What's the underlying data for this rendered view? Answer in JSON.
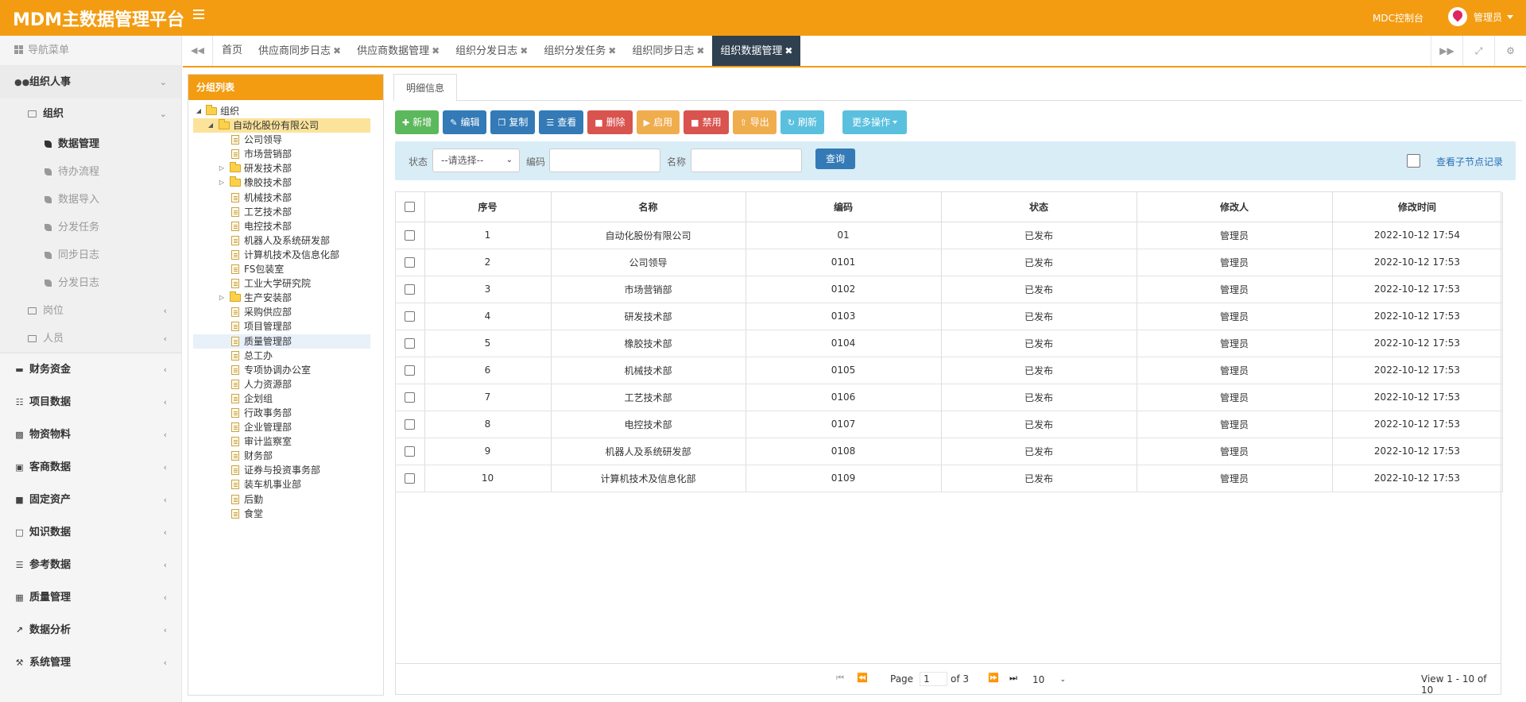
{
  "header": {
    "app_title": "MDM主数据管理平台",
    "console_link": "MDC控制台",
    "user_name": "管理员"
  },
  "sidebar": {
    "nav_title": "导航菜单",
    "groups": [
      {
        "label": "组织人事",
        "icon": "users-icon"
      },
      {
        "label": "财务资金",
        "icon": "card-icon"
      },
      {
        "label": "项目数据",
        "icon": "sitemap-icon"
      },
      {
        "label": "物资物料",
        "icon": "cubes-icon"
      },
      {
        "label": "客商数据",
        "icon": "briefcase-icon"
      },
      {
        "label": "固定资产",
        "icon": "archive-icon"
      },
      {
        "label": "知识数据",
        "icon": "file-icon"
      },
      {
        "label": "参考数据",
        "icon": "list-icon"
      },
      {
        "label": "质量管理",
        "icon": "table-icon"
      },
      {
        "label": "数据分析",
        "icon": "chart-icon"
      },
      {
        "label": "系统管理",
        "icon": "wrench-icon"
      }
    ],
    "org_label": "组织",
    "org_items": [
      "数据管理",
      "待办流程",
      "数据导入",
      "分发任务",
      "同步日志",
      "分发日志"
    ],
    "post_label": "岗位",
    "person_label": "人员"
  },
  "tabs": [
    "首页",
    "供应商同步日志",
    "供应商数据管理",
    "组织分发日志",
    "组织分发任务",
    "组织同步日志",
    "组织数据管理"
  ],
  "tree": {
    "title": "分组列表",
    "root": "组织",
    "company": "自动化股份有限公司",
    "children": [
      {
        "label": "公司领导",
        "type": "doc"
      },
      {
        "label": "市场营销部",
        "type": "doc"
      },
      {
        "label": "研发技术部",
        "type": "folder"
      },
      {
        "label": "橡胶技术部",
        "type": "folder"
      },
      {
        "label": "机械技术部",
        "type": "doc"
      },
      {
        "label": "工艺技术部",
        "type": "doc"
      },
      {
        "label": "电控技术部",
        "type": "doc"
      },
      {
        "label": "机器人及系统研发部",
        "type": "doc"
      },
      {
        "label": "计算机技术及信息化部",
        "type": "doc"
      },
      {
        "label": "FS包装室",
        "type": "doc"
      },
      {
        "label": "工业大学研究院",
        "type": "doc"
      },
      {
        "label": "生产安装部",
        "type": "folder"
      },
      {
        "label": "采购供应部",
        "type": "doc"
      },
      {
        "label": "项目管理部",
        "type": "doc"
      },
      {
        "label": "质量管理部",
        "type": "doc"
      },
      {
        "label": "总工办",
        "type": "doc"
      },
      {
        "label": "专项协调办公室",
        "type": "doc"
      },
      {
        "label": "人力资源部",
        "type": "doc"
      },
      {
        "label": "企划组",
        "type": "doc"
      },
      {
        "label": "行政事务部",
        "type": "doc"
      },
      {
        "label": "企业管理部",
        "type": "doc"
      },
      {
        "label": "审计监察室",
        "type": "doc"
      },
      {
        "label": "财务部",
        "type": "doc"
      },
      {
        "label": "证券与投资事务部",
        "type": "doc"
      },
      {
        "label": "装车机事业部",
        "type": "doc"
      },
      {
        "label": "后勤",
        "type": "doc"
      },
      {
        "label": "食堂",
        "type": "doc"
      }
    ]
  },
  "detail": {
    "tab_label": "明细信息"
  },
  "toolbar": {
    "add": "新增",
    "edit": "编辑",
    "copy": "复制",
    "view": "查看",
    "delete": "删除",
    "enable": "启用",
    "disable": "禁用",
    "export": "导出",
    "refresh": "刷新",
    "more": "更多操作"
  },
  "search": {
    "status_label": "状态",
    "status_value": "--请选择--",
    "code_label": "编码",
    "name_label": "名称",
    "query_button": "查询",
    "child_records_label": "查看子节点记录"
  },
  "table": {
    "columns": [
      "序号",
      "名称",
      "编码",
      "状态",
      "修改人",
      "修改时间"
    ],
    "rows": [
      [
        "1",
        "自动化股份有限公司",
        "01",
        "已发布",
        "管理员",
        "2022-10-12 17:54"
      ],
      [
        "2",
        "公司领导",
        "0101",
        "已发布",
        "管理员",
        "2022-10-12 17:53"
      ],
      [
        "3",
        "市场营销部",
        "0102",
        "已发布",
        "管理员",
        "2022-10-12 17:53"
      ],
      [
        "4",
        "研发技术部",
        "0103",
        "已发布",
        "管理员",
        "2022-10-12 17:53"
      ],
      [
        "5",
        "橡胶技术部",
        "0104",
        "已发布",
        "管理员",
        "2022-10-12 17:53"
      ],
      [
        "6",
        "机械技术部",
        "0105",
        "已发布",
        "管理员",
        "2022-10-12 17:53"
      ],
      [
        "7",
        "工艺技术部",
        "0106",
        "已发布",
        "管理员",
        "2022-10-12 17:53"
      ],
      [
        "8",
        "电控技术部",
        "0107",
        "已发布",
        "管理员",
        "2022-10-12 17:53"
      ],
      [
        "9",
        "机器人及系统研发部",
        "0108",
        "已发布",
        "管理员",
        "2022-10-12 17:53"
      ],
      [
        "10",
        "计算机技术及信息化部",
        "0109",
        "已发布",
        "管理员",
        "2022-10-12 17:53"
      ]
    ]
  },
  "pager": {
    "page_label": "Page",
    "page_value": "1",
    "of_label": "of 3",
    "page_size": "10",
    "view_text": "View 1 - 10 of 10"
  },
  "colors": {
    "brand": "#f39c12",
    "active_tab": "#2f4050",
    "search_bg": "#d9edf7"
  }
}
